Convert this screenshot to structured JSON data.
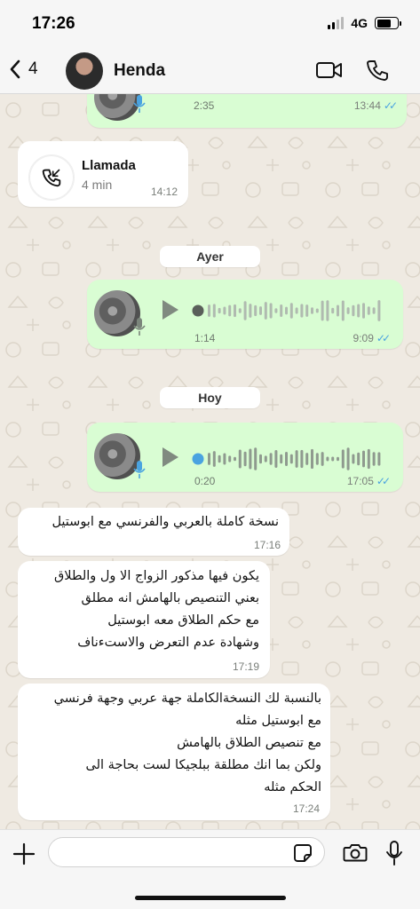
{
  "status_bar": {
    "time": "17:26",
    "network": "4G",
    "battery_level": 0.7
  },
  "header": {
    "back_count": "4",
    "contact_name": "Henda",
    "icons": [
      "chevron-left-icon",
      "video-camera-icon",
      "phone-icon"
    ]
  },
  "colors": {
    "outgoing_bubble": "#d9fdd3",
    "incoming_bubble": "#ffffff",
    "read_ticks": "#4aa3e0",
    "chat_bg": "#efeae2"
  },
  "messages": {
    "voice_top": {
      "duration": "2:35",
      "time": "13:44",
      "read": true
    },
    "call": {
      "title": "Llamada",
      "duration": "4 min",
      "time": "14:12"
    },
    "date_ayer": "Ayer",
    "voice_ayer": {
      "duration": "1:14",
      "time": "9:09",
      "read": true,
      "progress": 0
    },
    "date_hoy": "Hoy",
    "voice_hoy": {
      "duration": "0:20",
      "time": "17:05",
      "read": true,
      "progress": 0
    },
    "text1": {
      "lines": [
        "نسخة كاملة بالعربي والفرنسي مع ابوستيل"
      ],
      "time": "17:16"
    },
    "text2": {
      "lines": [
        "يكون فيها مذكور الزواج الا ول والطلاق",
        "بعني التنصيص بالهامش انه مطلق",
        "مع حكم الطلاق معه ابوستيل",
        "وشهادة عدم التعرض والاستءناف"
      ],
      "time": "17:19"
    },
    "text3": {
      "lines": [
        "بالنسبة لك النسخةالكاملة جهة عربي وجهة فرنسي",
        "مع ابوستيل مثله",
        "مع تنصيص الطلاق بالهامش",
        "ولكن بما انك مطلقة ببلجيكا لست بحاجة الى",
        "الحكم مثله"
      ],
      "time": "17:24"
    }
  },
  "input": {
    "placeholder": "",
    "value": ""
  }
}
